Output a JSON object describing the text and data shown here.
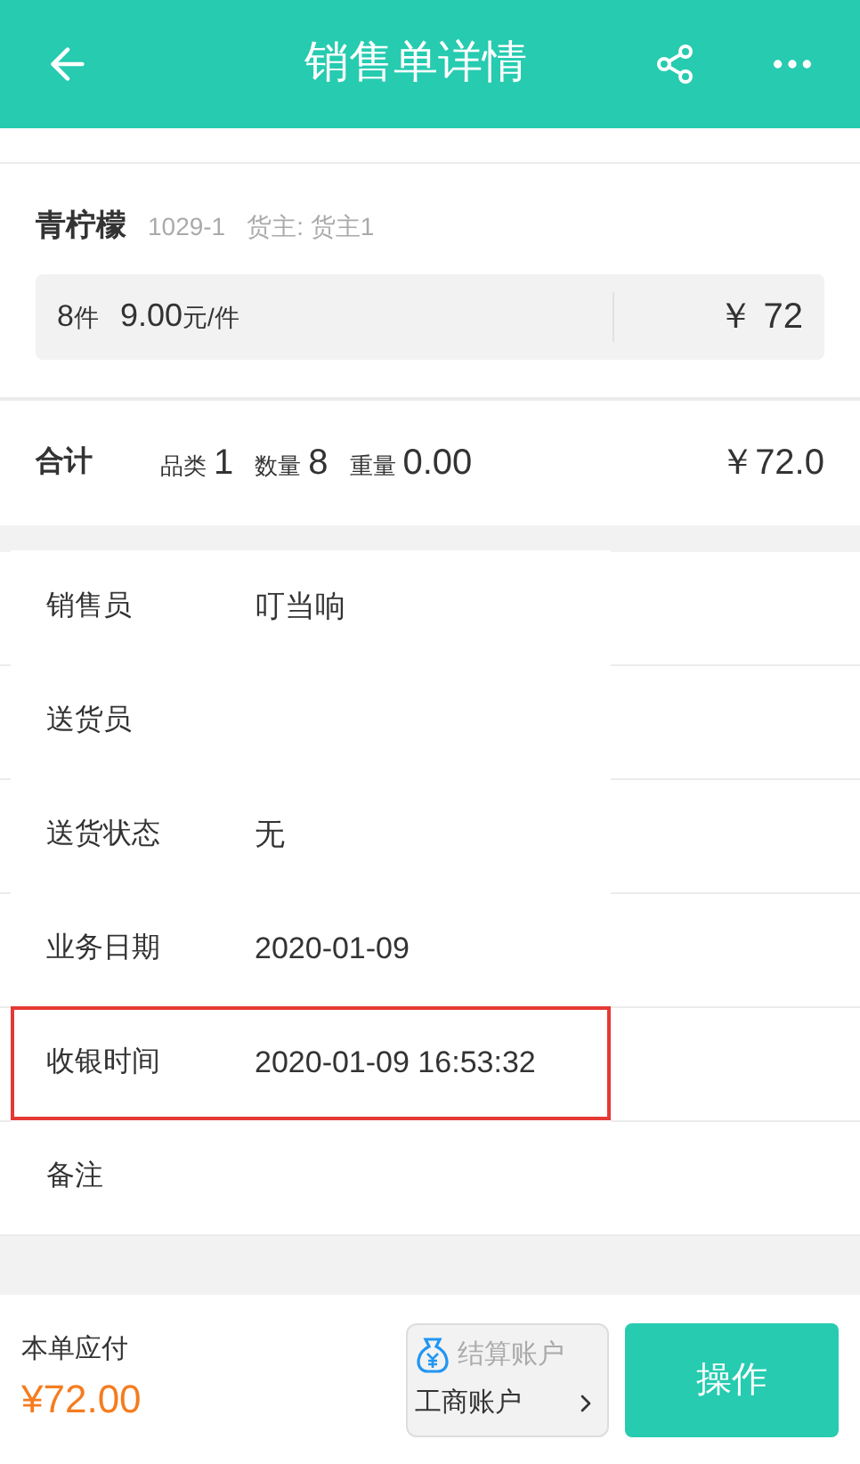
{
  "header": {
    "title": "销售单详情"
  },
  "product": {
    "name": "青柠檬",
    "code": "1029-1",
    "owner": "货主: 货主1",
    "quantity": "8",
    "quantity_unit": "件",
    "price": "9.00",
    "price_unit": "元/件",
    "amount": "￥ 72"
  },
  "total": {
    "label": "合计",
    "stats": [
      {
        "label": "品类",
        "value": "1"
      },
      {
        "label": "数量",
        "value": "8"
      },
      {
        "label": "重量",
        "value": "0.00"
      }
    ],
    "amount": "￥72.0"
  },
  "fields": [
    {
      "label": "销售员",
      "value": "叮当响",
      "highlighted": false
    },
    {
      "label": "送货员",
      "highlighted": false
    },
    {
      "label": "送货状态",
      "value": "无",
      "highlighted": false
    },
    {
      "label": "业务日期",
      "value": "2020-01-09",
      "highlighted": false
    },
    {
      "label": "收银时间",
      "value": "2020-01-09 16:53:32",
      "highlighted": true
    },
    {
      "label": "备注",
      "highlighted": false
    }
  ],
  "footer": {
    "payable_label": "本单应付",
    "payable": "¥72.00",
    "account_label": "结算账户",
    "account": "工商账户",
    "action": "操作"
  }
}
